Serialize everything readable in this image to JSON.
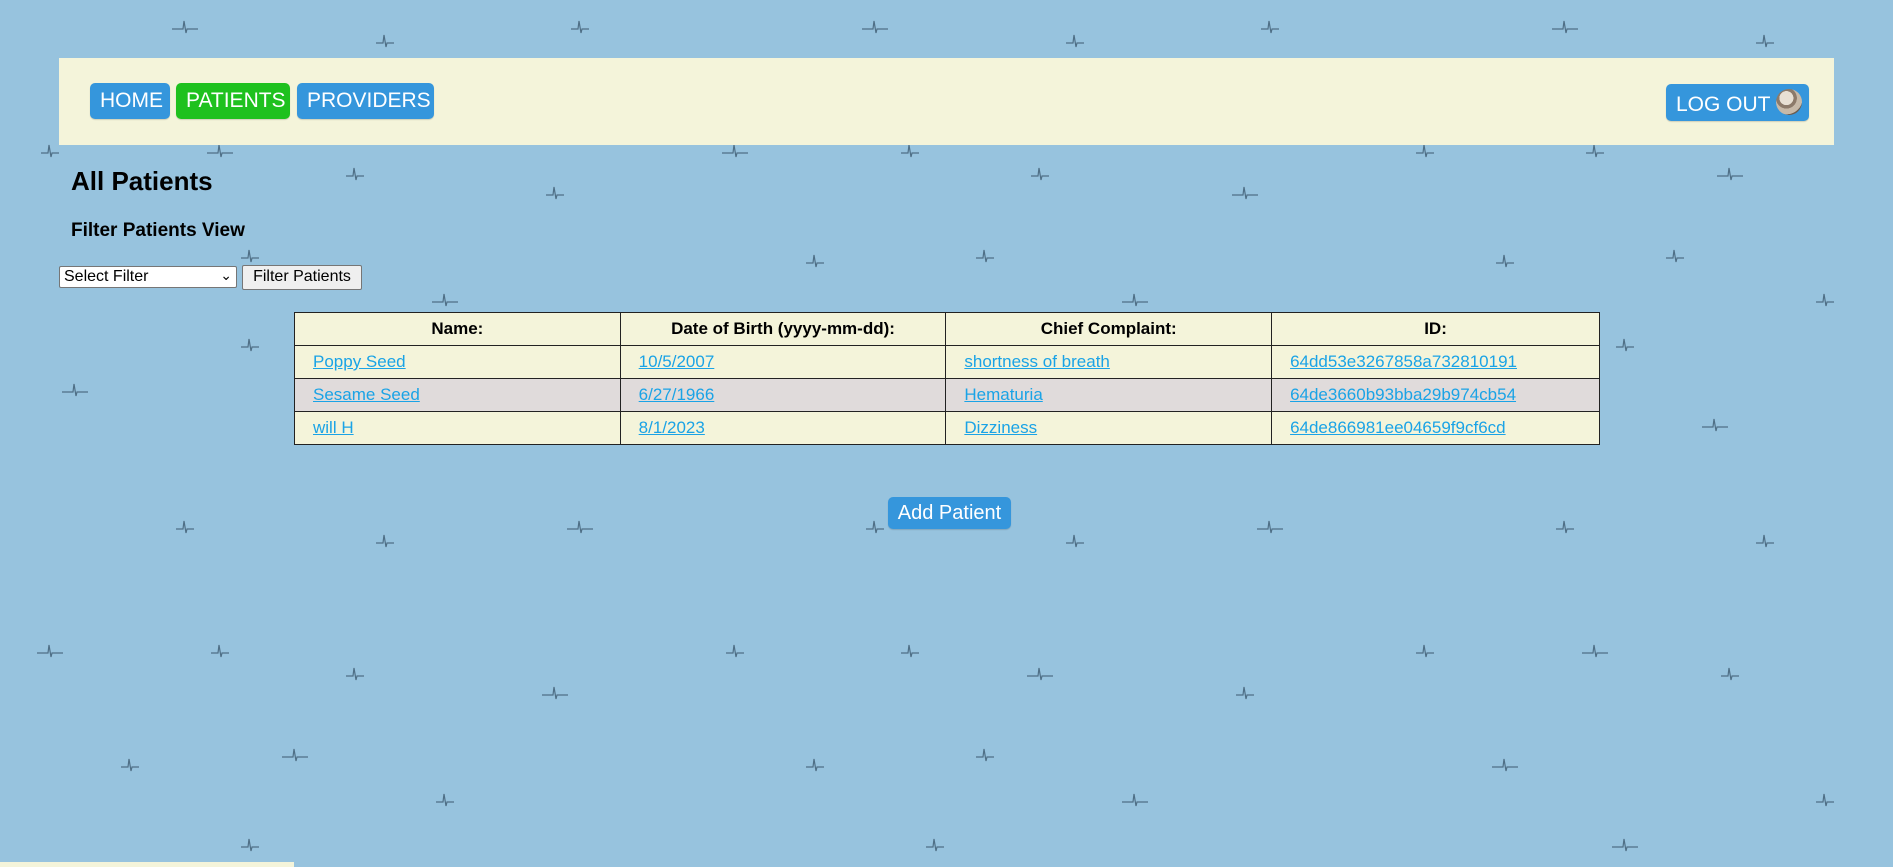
{
  "nav": {
    "home": "HOME",
    "patients": "PATIENTS",
    "providers": "PROVIDERS",
    "logout": "LOG OUT",
    "active_color": "#1ec11e",
    "button_color": "#3596dc"
  },
  "page": {
    "title": "All Patients",
    "filter_heading": "Filter Patients View"
  },
  "filter": {
    "selected": "Select Filter",
    "button": "Filter Patients"
  },
  "table": {
    "headers": [
      "Name:",
      "Date of Birth (yyyy-mm-dd):",
      "Chief Complaint:",
      "ID:"
    ],
    "rows": [
      [
        "Poppy Seed",
        "10/5/2007",
        "shortness of breath",
        "64dd53e3267858a732810191"
      ],
      [
        "Sesame Seed",
        "6/27/1966",
        "Hematuria",
        "64de3660b93bba29b974cb54"
      ],
      [
        "will H",
        "8/1/2023",
        "Dizziness",
        "64de866981ee04659f9cf6cd"
      ]
    ]
  },
  "actions": {
    "add_patient": "Add Patient"
  },
  "icons": {
    "avatar": "user-avatar-icon",
    "dropdown": "chevron-down-icon",
    "background": "ecg-pattern"
  }
}
